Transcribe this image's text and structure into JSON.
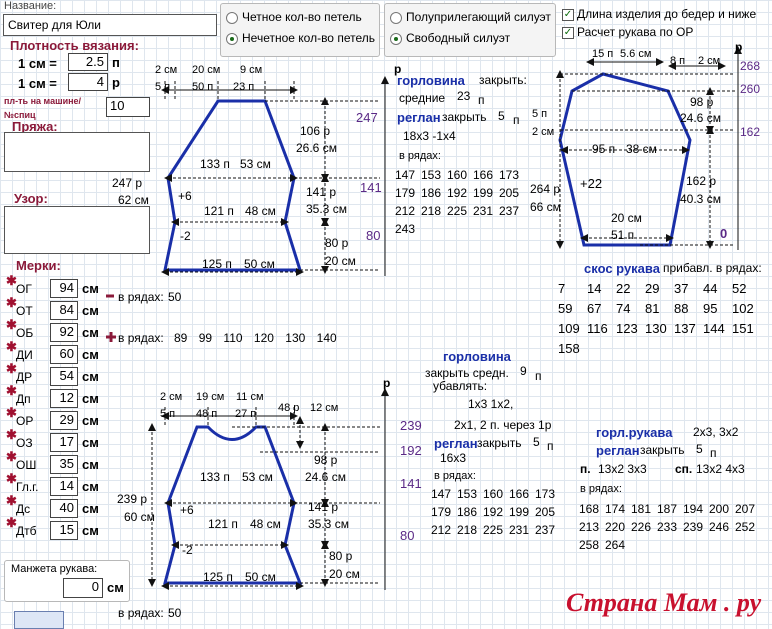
{
  "header": {
    "name_label": "Название:",
    "name_value": "Свитер для Юли"
  },
  "options": {
    "loops_even": "Четное кол-во петель",
    "loops_odd": "Нечетное кол-во петель",
    "fit_semi": "Полуприлегающий силуэт",
    "fit_free": "Свободный силуэт",
    "length_hips": "Длина изделия до бедер и ниже",
    "sleeve_calc": "Расчет рукава по ОР"
  },
  "density": {
    "title": "Плотность вязания:",
    "row1_label": "1 см =",
    "row1_value": "2.5",
    "row1_unit": "п",
    "row2_label": "1 см =",
    "row2_value": "4",
    "row2_unit": "р",
    "machine_label": "пл-ть на машине/ №спиц",
    "machine_value": "10"
  },
  "yarn": {
    "title": "Пряжа:",
    "rows": "247 р",
    "cm": "62 см"
  },
  "pattern": {
    "title": "Узор:"
  },
  "measures": {
    "title": "Мерки:",
    "unit": "см",
    "items": [
      {
        "label": "ОГ",
        "value": "94"
      },
      {
        "label": "ОТ",
        "value": "84"
      },
      {
        "label": "ОБ",
        "value": "92"
      },
      {
        "label": "ДИ",
        "value": "60"
      },
      {
        "label": "ДР",
        "value": "54"
      },
      {
        "label": "Дп",
        "value": "12"
      },
      {
        "label": "ОР",
        "value": "29"
      },
      {
        "label": "ОЗ",
        "value": "17"
      },
      {
        "label": "ОШ",
        "value": "35"
      },
      {
        "label": "Гл.г.",
        "value": "14"
      },
      {
        "label": "Дс",
        "value": "40"
      },
      {
        "label": "Дтб",
        "value": "15"
      }
    ],
    "cuff_label": "Манжета рукава:",
    "cuff_value": "0",
    "cuff_unit": "см"
  },
  "back": {
    "top_cm": [
      "2 см",
      "20 см",
      "9 см"
    ],
    "top_p": [
      "5 п",
      "50 п",
      "23 п"
    ],
    "p_label": "р",
    "h1": "106 р",
    "h1cm": "26.6 см",
    "w1": "133 п",
    "w1b": "53 см",
    "plus": "+6",
    "w2": "121 п",
    "w2b": "48 см",
    "minus": "-2",
    "w3": "125 п",
    "w3b": "50 см",
    "h2": "141 р",
    "h2cm": "35.3 см",
    "h3": "80 р",
    "h3cm": "20 см",
    "r247": "247",
    "r141": "141",
    "r80": "80",
    "dec_note": "в рядах:",
    "dec_val": "50",
    "inc_note": "в рядах:",
    "inc_rows": [
      "89",
      "99",
      "110",
      "120",
      "130",
      "140"
    ],
    "neck_title": "горловина",
    "neck_close": "закрыть:",
    "neck_mid": "средние",
    "neck_mid_val": "23",
    "neck_mid_unit": "п",
    "raglan": "реглан",
    "raglan_close": "закрыть",
    "raglan_val": "5",
    "raglan_unit": "п",
    "rag_formula": "18х3  -1х4",
    "rows_label": "в рядах:",
    "rows_grid": [
      [
        "147",
        "153",
        "160",
        "166",
        "173"
      ],
      [
        "179",
        "186",
        "192",
        "199",
        "205"
      ],
      [
        "212",
        "218",
        "225",
        "231",
        "237"
      ],
      [
        "243"
      ]
    ]
  },
  "sleeve": {
    "top": "15 п",
    "top2": "5.6 см",
    "t3": "8 п",
    "t4": "2 см",
    "r268": "268",
    "r260": "260",
    "r162": "162",
    "r0": "0",
    "side5": "5 п",
    "side2": "2 см",
    "h98": "98 р",
    "h246": "24.6 см",
    "w95": "95 п",
    "w38": "38 см",
    "plus22": "+22",
    "h264": "264 р",
    "h66": "66 см",
    "h162": "162 р",
    "h403": "40.3 см",
    "bw1": "20 см",
    "bw2": "51 п",
    "p_label": "р",
    "bevel_title": "скос рукава",
    "bevel_note": "прибавл. в рядах:",
    "bevel_grid": [
      [
        "7",
        "14",
        "22",
        "29",
        "37",
        "44",
        "52"
      ],
      [
        "59",
        "67",
        "74",
        "81",
        "88",
        "95",
        "102"
      ],
      [
        "109",
        "116",
        "123",
        "130",
        "137",
        "144",
        "151"
      ],
      [
        "158"
      ]
    ]
  },
  "front": {
    "top_cm": [
      "2 см",
      "19 см",
      "11 см"
    ],
    "top_p": [
      "5 п",
      "48 п",
      "27 п"
    ],
    "r48": "48 р",
    "r12": "12 см",
    "p_label": "р",
    "h98": "98 р",
    "h246": "24.6 см",
    "w1": "133 п",
    "w1b": "53 см",
    "plus": "+6",
    "w2": "121 п",
    "w2b": "48 см",
    "minus": "-2",
    "w3": "125 п",
    "w3b": "50 см",
    "h141": "141 р",
    "h353": "35.3 см",
    "h80": "80 р",
    "h20": "20 см",
    "left239": "239 р",
    "left60": "60 см",
    "r239": "239",
    "r192": "192",
    "r141": "141",
    "r80": "80",
    "bottom_note": "в рядах:",
    "bottom_val": "50",
    "neck_title": "горловина",
    "neck_mid": "закрыть средн.",
    "neck_mid_val": "9",
    "neck_mid_unit": "п",
    "dec": "убавлять:",
    "dec1": "1х3  1х2,",
    "dec2": "2х1,  2 п. через 1р",
    "raglan": "реглан",
    "raglan_close": "закрыть",
    "raglan_val": "5",
    "raglan_unit": "п",
    "rag_formula": "16х3",
    "rows_label": "в рядах:",
    "rows_grid": [
      [
        "147",
        "153",
        "160",
        "166",
        "173"
      ],
      [
        "179",
        "186",
        "192",
        "199",
        "205"
      ],
      [
        "212",
        "218",
        "225",
        "231",
        "237"
      ]
    ]
  },
  "sleeve_neck": {
    "title": "горл.рукава",
    "formula": "2х3,  3х2",
    "raglan": "реглан",
    "close": "закрыть",
    "val": "5",
    "unit": "п",
    "p_label": "п.",
    "p_val": "13х2 3х3",
    "sp_label": "сп.",
    "sp_val": "13х2 4х3",
    "rows_label": "в рядах:",
    "rows_grid": [
      [
        "168",
        "174",
        "181",
        "187",
        "194",
        "200",
        "207"
      ],
      [
        "213",
        "220",
        "226",
        "233",
        "239",
        "246",
        "252"
      ],
      [
        "258",
        "264"
      ]
    ]
  },
  "watermark": "Страна Мам . ру",
  "colors": {
    "accent": "#8b1a3a",
    "shape": "#1a2fa8",
    "purple": "#5b2a86"
  }
}
